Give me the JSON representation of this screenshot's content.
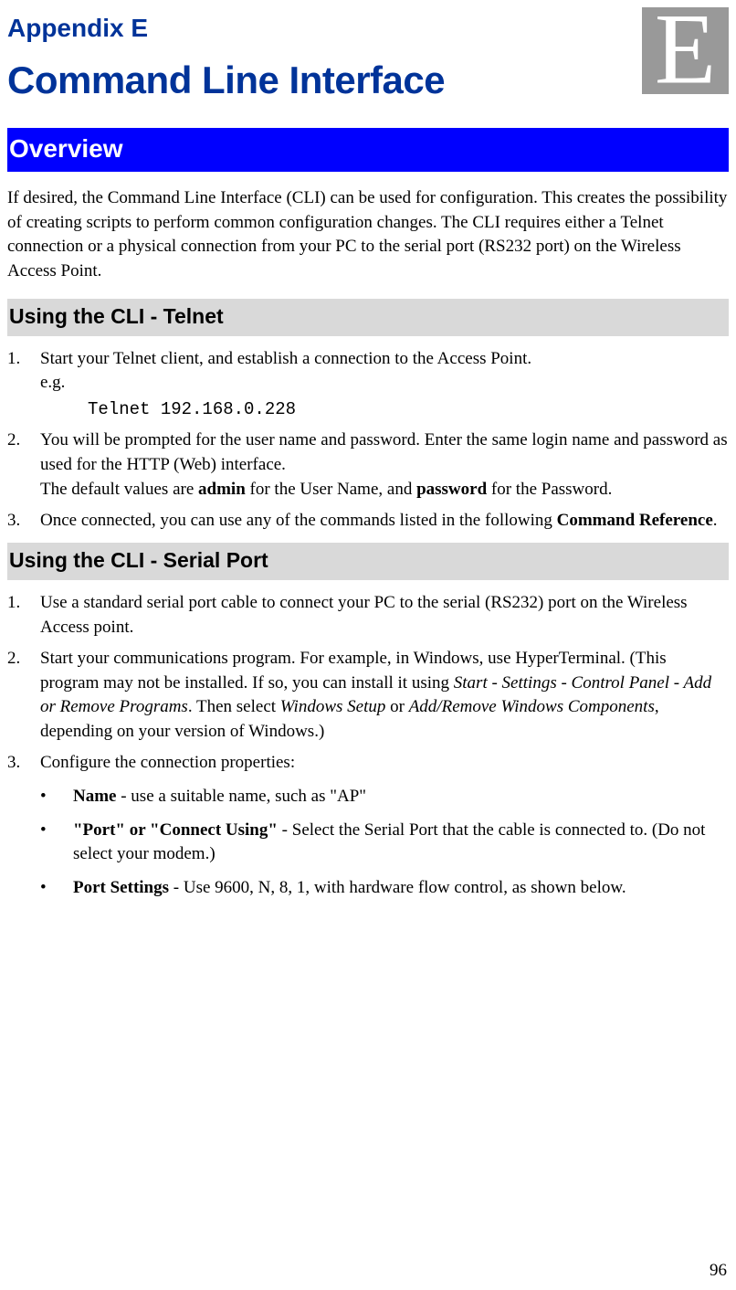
{
  "header": {
    "appendix_label": "Appendix E",
    "title": "Command Line Interface",
    "corner_letter": "E"
  },
  "overview": {
    "heading": "Overview",
    "paragraph": "If desired, the Command Line Interface (CLI) can be used for configuration. This creates the possibility of creating scripts to perform common configuration changes. The CLI requires either a Telnet connection or a physical connection from your PC to the serial port (RS232 port) on the Wireless Access Point."
  },
  "telnet": {
    "heading": "Using the CLI - Telnet",
    "items": [
      {
        "line1": "Start your Telnet client, and establish a connection to the Access Point.",
        "line2": "e.g.",
        "code": "Telnet 192.168.0.228"
      },
      {
        "text_a": "You will be prompted for the user name and password. Enter the same login name and password as used for the HTTP (Web) interface.",
        "text_b_pre": "The default values are ",
        "admin": "admin",
        "text_b_mid": " for the User Name, and ",
        "password": "password",
        "text_b_post": " for the Password."
      },
      {
        "text_pre": "Once connected, you can use any of the commands listed in the following ",
        "cmdref": "Command Reference",
        "text_post": "."
      }
    ]
  },
  "serial": {
    "heading": "Using the CLI - Serial Port",
    "items": [
      "Use a standard serial port cable to connect your PC to the serial (RS232) port on the Wireless Access point.",
      {
        "pre": "Start your communications program. For example, in Windows, use HyperTerminal. (This program may not be installed. If so, you can install it using ",
        "it1": "Start - Settings - Control Panel - Add or Remove Programs",
        "mid": ". Then select ",
        "it2": "Windows Setup",
        "or": " or ",
        "it3": "Add/Remove Windows Components",
        "post": ", depending on your version of Windows.)"
      },
      "Configure the connection properties:"
    ],
    "bullets": [
      {
        "b": "Name",
        "t": " - use a suitable name, such as \"AP\""
      },
      {
        "b": "\"Port\" or \"Connect Using\"",
        "t": " - Select the Serial Port that the cable is connected to. (Do not select your modem.)"
      },
      {
        "b": "Port Settings",
        "t": " - Use 9600, N, 8, 1, with hardware flow control, as shown below."
      }
    ]
  },
  "page_number": "96"
}
